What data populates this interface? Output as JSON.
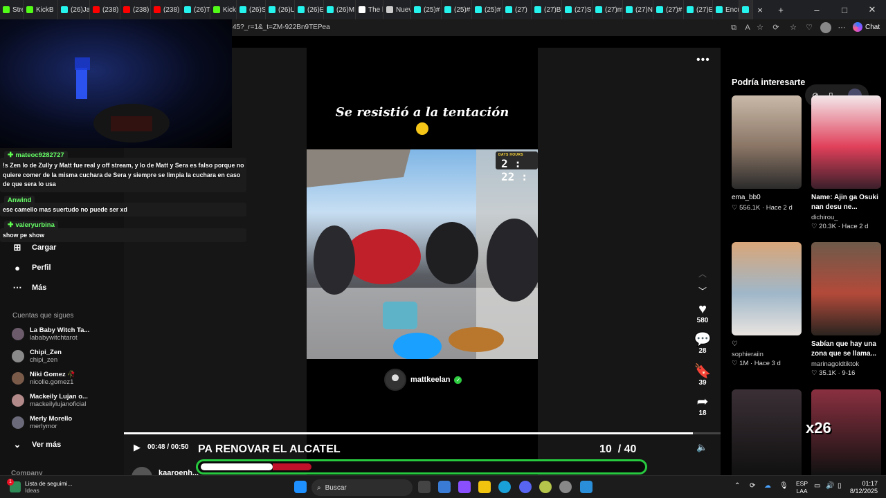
{
  "browser": {
    "tabs": [
      {
        "label": "Strea",
        "color": "#53fc18"
      },
      {
        "label": "KickB",
        "color": "#53fc18"
      },
      {
        "label": "(26)Ja",
        "color": "#25f4ee"
      },
      {
        "label": "(238)",
        "color": "#ff0000"
      },
      {
        "label": "(238)",
        "color": "#ff0000"
      },
      {
        "label": "(238)",
        "color": "#ff0000"
      },
      {
        "label": "(26)Ti",
        "color": "#25f4ee"
      },
      {
        "label": "Kick",
        "color": "#53fc18"
      },
      {
        "label": "(26)S",
        "color": "#25f4ee"
      },
      {
        "label": "(26)L",
        "color": "#25f4ee"
      },
      {
        "label": "(26)E",
        "color": "#25f4ee"
      },
      {
        "label": "(26)M",
        "color": "#25f4ee"
      },
      {
        "label": "The b",
        "color": "#ffffff"
      },
      {
        "label": "Nuev",
        "color": "#cccccc"
      },
      {
        "label": "(25)#",
        "color": "#25f4ee"
      },
      {
        "label": "(25)#",
        "color": "#25f4ee"
      },
      {
        "label": "(25)#",
        "color": "#25f4ee"
      },
      {
        "label": "(27)",
        "color": "#25f4ee"
      },
      {
        "label": "(27)B",
        "color": "#25f4ee"
      },
      {
        "label": "(27)S",
        "color": "#25f4ee"
      },
      {
        "label": "(27)m",
        "color": "#25f4ee"
      },
      {
        "label": "(27)N",
        "color": "#25f4ee"
      },
      {
        "label": "(27)#",
        "color": "#25f4ee"
      },
      {
        "label": "(27)E",
        "color": "#25f4ee"
      },
      {
        "label": "Encu",
        "color": "#25f4ee"
      },
      {
        "label": "",
        "color": "#25f4ee"
      }
    ],
    "url": "45?_r=1&_t=ZM-922Bn9TEPea",
    "chat_label": "Chat"
  },
  "stream_chat": {
    "messages": [
      {
        "user": "mateoc9282727",
        "text": "!s Zen lo de Zully y Matt fue real y off stream, y lo de Matt y Sera es falso porque no quiere comer de la misma cuchara de Sera y siempre se limpia la cuchara en caso de que sera lo usa"
      },
      {
        "user": "Anwind",
        "text": "ese camello mas suertudo no puede ser xd"
      },
      {
        "user": "valeryurbina",
        "text": "show pe show"
      }
    ]
  },
  "sidebar": {
    "nav": [
      {
        "label": "Cargar",
        "icon": "plus-square-icon"
      },
      {
        "label": "Perfil",
        "icon": "profile-icon"
      },
      {
        "label": "Más",
        "icon": "more-icon"
      }
    ],
    "following_title": "Cuentas que sigues",
    "following": [
      {
        "name": "La Baby Witch Ta...",
        "user": "lababywitchtarot"
      },
      {
        "name": "Chipi_Zen",
        "user": "chipi_zen"
      },
      {
        "name": "Niki Gomez 🥀",
        "user": "nicolle.gomez1"
      },
      {
        "name": "Mackeily Lujan o...",
        "user": "mackeilylujanoficial"
      },
      {
        "name": "Merly Morello",
        "user": "merlymor"
      }
    ],
    "see_more": "Ver más",
    "company": "Company"
  },
  "video": {
    "caption": "Se resistió a la tentación",
    "timer_label": "DAYS  HOURS",
    "timer_value": "2 : 22 :",
    "author": "mattkeelan",
    "likes": "580",
    "comments": "28",
    "saves": "39",
    "shares": "18",
    "time": "00:48 / 00:50",
    "progress": 0.954,
    "bottom_user": "kaaroenh..."
  },
  "stream_overlay": {
    "title": "PA RENOVAR EL ALCATEL",
    "current": "10",
    "total": "/ 40",
    "fill": 0.25
  },
  "recommendations": {
    "title": "Podría interesarte",
    "cards": [
      {
        "title": "ema_bb0",
        "bold": false,
        "meta": "♡ 556.1K · Hace 2 d",
        "user": "",
        "palette": [
          "#c9b9a8",
          "#8a7565",
          "#2b2b2b"
        ]
      },
      {
        "title": "Name: Ajin ga Osuki nan desu ne...",
        "bold": true,
        "meta": "",
        "user": "dichirou_",
        "meta2": "♡ 20.3K · Hace 2 d",
        "palette": [
          "#f3e7ea",
          "#e0405a",
          "#3a1f2a"
        ]
      },
      {
        "title": "♡",
        "bold": false,
        "meta": "",
        "user": "sophieraiin",
        "meta2": "♡ 1M · Hace 3 d",
        "palette": [
          "#d9a679",
          "#9fb7c9",
          "#e9e4e0"
        ]
      },
      {
        "title": "Sabían que hay una zona que se llama...",
        "bold": true,
        "meta": "",
        "user": "marinagoldtiktok",
        "meta2": "♡ 35.1K · 9-16",
        "palette": [
          "#6e5a4a",
          "#b34a3a",
          "#2a2420"
        ]
      }
    ],
    "overlay_text": "x26"
  },
  "taskbar": {
    "news_title": "Lista de seguimi...",
    "news_sub": "Ideas",
    "news_badge": "1",
    "search": "Buscar",
    "lang_top": "ESP",
    "lang_bottom": "LAA",
    "time": "01:17",
    "date": "8/12/2025"
  }
}
